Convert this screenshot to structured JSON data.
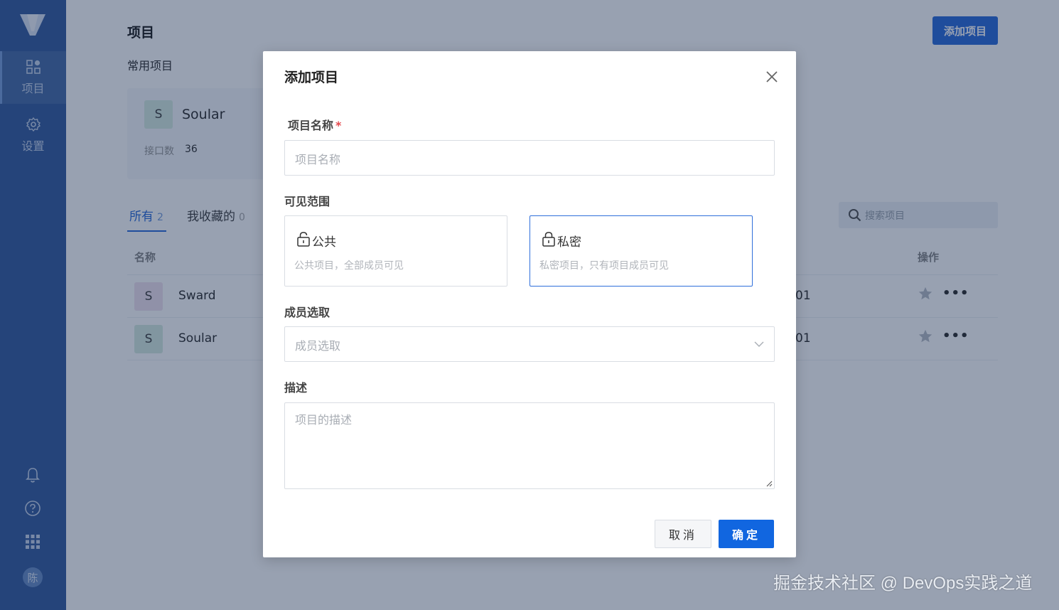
{
  "sidebar": {
    "nav": [
      {
        "label": "项目",
        "icon": "apps-icon"
      },
      {
        "label": "设置",
        "icon": "gear-icon"
      }
    ],
    "bottom_icons": [
      "bell-icon",
      "help-icon",
      "grid-icon"
    ],
    "avatar_text": "陈"
  },
  "header": {
    "title": "项目",
    "add_button": "添加项目"
  },
  "favorites": {
    "title": "常用项目",
    "card": {
      "avatar": "S",
      "name": "Soular",
      "stat_label": "接口数",
      "stat_value": "36"
    }
  },
  "tabs": [
    {
      "label": "所有",
      "count": "2"
    },
    {
      "label": "我收藏的",
      "count": "0"
    }
  ],
  "search": {
    "placeholder": "搜索项目"
  },
  "table": {
    "headers": {
      "name": "名称",
      "actions": "操作"
    },
    "rows": [
      {
        "avatar": "S",
        "name": "Sward",
        "date_fragment": "01",
        "more": "•••"
      },
      {
        "avatar": "S",
        "name": "Soular",
        "date_fragment": "01",
        "more": "•••"
      }
    ]
  },
  "modal": {
    "title": "添加项目",
    "name_label": "项目名称",
    "name_required_mark": "*",
    "name_placeholder": "项目名称",
    "visibility_label": "可见范围",
    "visibility_options": [
      {
        "title": "公共",
        "desc": "公共项目，全部成员可见",
        "selected": false
      },
      {
        "title": "私密",
        "desc": "私密项目，只有项目成员可见",
        "selected": true
      }
    ],
    "members_label": "成员选取",
    "members_placeholder": "成员选取",
    "desc_label": "描述",
    "desc_placeholder": "项目的描述",
    "cancel": "取消",
    "ok": "确定"
  },
  "watermark": "掘金技术社区 @ DevOps实践之道",
  "colors": {
    "sidebar": "#3a5fa0",
    "primary": "#1166e0",
    "required": "#e5484d"
  }
}
